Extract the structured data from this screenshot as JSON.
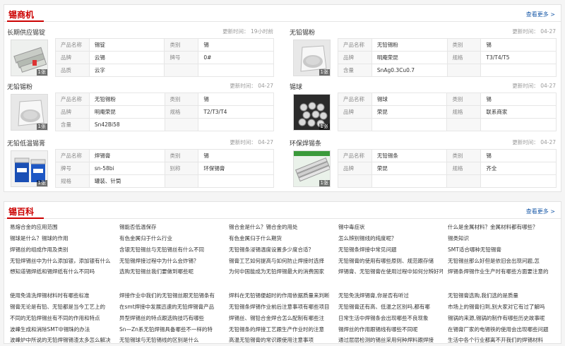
{
  "shangji": {
    "title": "锡商机",
    "more": "查看更多 >",
    "cards": [
      {
        "title": "长期供应锡锭",
        "time": "更新时间： 19小时前",
        "img_count": "1张",
        "image": "tin-ingot",
        "rows": [
          [
            "产品名称",
            "锡锭",
            "类别",
            "锡"
          ],
          [
            "品牌",
            "云锡",
            "牌号",
            "0#"
          ],
          [
            "品质",
            "云字",
            "",
            ""
          ]
        ]
      },
      {
        "title": "无铅锡粉",
        "time": "更新时间： 04-27",
        "img_count": "1张",
        "image": "tin-powder-bag",
        "rows": [
          [
            "产品名称",
            "无铅锡粉",
            "类别",
            "锡"
          ],
          [
            "品牌",
            "明庵荣昆",
            "规格",
            "T3/T4/T5"
          ],
          [
            "含量",
            "SnAg0.3Cu0.7",
            "",
            ""
          ]
        ]
      },
      {
        "title": "无铅锡粉",
        "time": "更新时间： 04-27",
        "img_count": "1张",
        "image": "tin-powder-bag",
        "rows": [
          [
            "产品名称",
            "无铅锡粉",
            "类别",
            "锡"
          ],
          [
            "品牌",
            "明庵荣昆",
            "规格",
            "T2/T3/T4"
          ],
          [
            "含量",
            "Sn42Bi58",
            "",
            ""
          ]
        ]
      },
      {
        "title": "锡球",
        "time": "更新时间： 04-27",
        "img_count": "1张",
        "image": "tin-balls",
        "rows": [
          [
            "产品名称",
            "锡球",
            "类别",
            "锡"
          ],
          [
            "品牌",
            "荣昆",
            "规格",
            "联系商家"
          ],
          [
            "",
            "",
            "",
            ""
          ]
        ]
      },
      {
        "title": "无铅低温锡膏",
        "time": "更新时间： 04-27",
        "img_count": "1张",
        "image": "solder-paste-jars",
        "rows": [
          [
            "产品名称",
            "焊锡膏",
            "类别",
            "锡"
          ],
          [
            "牌号",
            "sn-58bi",
            "别称",
            "环保锡膏"
          ],
          [
            "规格",
            "罐装、针筒",
            "",
            ""
          ]
        ]
      },
      {
        "title": "环保焊锡条",
        "time": "更新时间： 04-27",
        "img_count": "1张",
        "image": "solder-bars",
        "rows": [
          [
            "产品名称",
            "无铅锡条",
            "类别",
            "锡"
          ],
          [
            "品牌",
            "荣昆",
            "规格",
            "齐全"
          ],
          [
            "",
            "",
            "",
            ""
          ]
        ]
      }
    ]
  },
  "baike": {
    "title": "锡百科",
    "more": "查看更多 >",
    "columns": [
      [
        "易熔合金的应用范围",
        "锡球是什么？锡球的作用",
        "焊锡丝的组成作用及类别",
        "无铅焊锡丝中为什么添加银，添加银有什么",
        "想知道锡焊纸和锡焊纸有什么不同吗",
        "",
        "使用免清洗焊锡材料时有哪些标准",
        "锡膏无论是有铅、无铅都是当今工艺上的",
        "不同的无铅焊锡丝有不同的作用和特点",
        "波峰生成和消除SMT中锡珠的办法",
        "波峰炉中所说的无铅焊锡锡渣太多怎么解决"
      ],
      [
        "锡能否低温保存",
        "有色金属归于什么行业",
        "含银无铅锡丝与无铅锡丝有什么不同",
        "无铅锡焊接过程中为什么会炸锡？",
        "选购无铅锡丝我们要做到哪些呢",
        "",
        "焊接作业中我们的无铅锡丝跟无铅锡条有",
        "在smt焊接中发展迅速的无铅焊锡膏产品",
        "异型焊锡丝的特点跟选购技巧有哪些",
        "Sn—Zn系无铅焊锡具备哪些不一样的特",
        "无铅锡球与无铅锡线的区别是什么"
      ],
      [
        "锡合金是什么？锡合金的用处",
        "有色金属归于什么期货",
        "无铅锡条浸锡温度设置多少度合适？",
        "锡膏工艺如何提高与如何防止焊接时选择",
        "为何中国能成为无铅焊锡最大的消费国家",
        "",
        "焊料在无铅锡便超时的作用依据质量来判断",
        "无铅锡条焊锡作业前后注意事项有哪些项目",
        "焊锡丝、锡铅合金焊合怎么配制有哪些注",
        "无铅锡条的焊接工艺跟生产作业时的注意",
        "高温无铅锡膏的常识跟使用注意事项"
      ],
      [
        "锡中毒症状",
        "怎么辨别锡线的纯度呢？",
        "无铅锡条焊接中常见问题",
        "无铅锡膏的使用有哪些原则、规范跟存储",
        "焊锡膏、无铅锡膏在使用过程中如何分辨好坏",
        "",
        "无铅免洗焊锡膏,你是否有听过",
        "无铅锡膏还有高、低温之区别吗,都有哪",
        "日常生活中焊锡条会出现哪些不良现象",
        "锡焊丝的作用跟锡线有哪些不同呢",
        "通过层层检测的锡丝采用何种焊料跟焊接"
      ],
      [
        "什么是金属材料？金属材料都有哪些？",
        "锡类知识",
        "SMT适合哪种无铅锡膏",
        "无铅锡丝那么好但是依旧会出现问题,怎",
        "焊锡条焊锡作业生产时有哪些方面要注意的",
        "",
        "无铅锡膏选购,我们选的是质量",
        "市场上的锡膏扫到,别大家对它有过了解吗",
        "锡锅的来源,锡锅的制作有哪些历史故事呢",
        "在锡膏厂家的电锡铁的使用会出现哪些问题",
        "生活中各个行业都离不开我们的焊锡材料"
      ]
    ]
  }
}
